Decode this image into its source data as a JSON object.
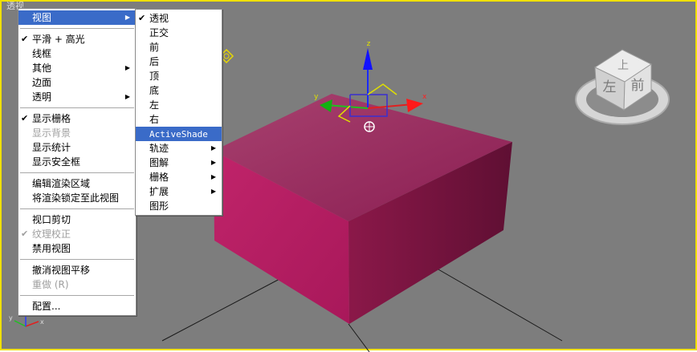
{
  "viewport": {
    "label": "透视"
  },
  "colors": {
    "viewport_bg": "#7d7d7d",
    "active_border": "#f0e000",
    "box_top": "#9c2f64",
    "box_front": "#b51e5f",
    "box_side": "#781440",
    "menu_highlight": "#3a6bc8"
  },
  "context_menu": {
    "items": [
      {
        "label": "视图",
        "submenu": true,
        "highlighted": true
      },
      {
        "separator": true
      },
      {
        "label": "平滑 + 高光",
        "checked": true
      },
      {
        "label": "线框"
      },
      {
        "label": "其他",
        "submenu": true
      },
      {
        "label": "边面"
      },
      {
        "label": "透明",
        "submenu": true
      },
      {
        "separator": true
      },
      {
        "label": "显示栅格",
        "checked": true
      },
      {
        "label": "显示背景",
        "disabled": true
      },
      {
        "label": "显示统计"
      },
      {
        "label": "显示安全框"
      },
      {
        "separator": true
      },
      {
        "label": "编辑渲染区域"
      },
      {
        "label": "将渲染锁定至此视图"
      },
      {
        "separator": true
      },
      {
        "label": "视口剪切"
      },
      {
        "label": "纹理校正",
        "checked": true,
        "disabled": true
      },
      {
        "label": "禁用视图"
      },
      {
        "separator": true
      },
      {
        "label": "撤消视图平移"
      },
      {
        "label": "重做 (R)",
        "disabled": true
      },
      {
        "separator": true
      },
      {
        "label": "配置..."
      }
    ]
  },
  "view_submenu": {
    "items": [
      {
        "label": "透视",
        "checked": true
      },
      {
        "label": "正交"
      },
      {
        "label": "前"
      },
      {
        "label": "后"
      },
      {
        "label": "顶"
      },
      {
        "label": "底"
      },
      {
        "label": "左"
      },
      {
        "label": "右"
      },
      {
        "label": "ActiveShade",
        "highlighted": true
      },
      {
        "label": "轨迹",
        "submenu": true
      },
      {
        "label": "图解",
        "submenu": true
      },
      {
        "label": "栅格",
        "submenu": true
      },
      {
        "label": "扩展",
        "submenu": true
      },
      {
        "label": "图形"
      }
    ]
  },
  "gizmo": {
    "x_label": "x",
    "y_label": "y",
    "z_label": "z"
  },
  "viewcube": {
    "face_top": "上",
    "face_left": "左",
    "face_front": "前"
  },
  "axis_tripod": {
    "x_label": "x",
    "y_label": "y",
    "z_label": "z"
  }
}
